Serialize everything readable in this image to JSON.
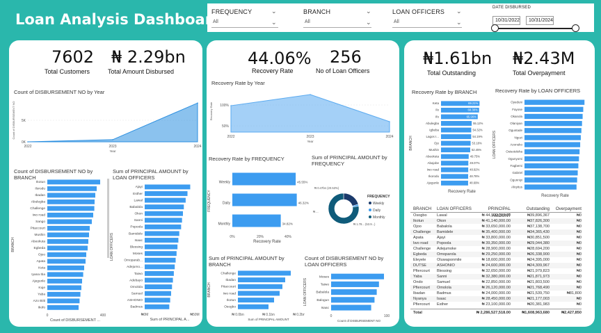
{
  "app_title": "Loan Analysis Dashboard",
  "filters": {
    "frequency": {
      "label": "FREQUENCY",
      "value": "All"
    },
    "branch": {
      "label": "BRANCH",
      "value": "All"
    },
    "loan_officers": {
      "label": "LOAN OFFICERS",
      "value": "All"
    },
    "date": {
      "label": "DATE DISBURSED",
      "start": "10/31/2022",
      "end": "10/31/2024"
    }
  },
  "kpis": {
    "total_customers": {
      "value": "7602",
      "label": "Total Customers"
    },
    "total_disbursed": {
      "value": "₦ 2.29bn",
      "label": "Total Amount Disbursed"
    },
    "recovery_rate": {
      "value": "44.06%",
      "label": "Recovery Rate"
    },
    "loan_officers": {
      "value": "256",
      "label": "No of Loan Officers"
    },
    "total_outstanding": {
      "value": "₦1.61bn",
      "label": "Total Outstanding"
    },
    "total_overpayment": {
      "value": "₦2.43M",
      "label": "Total Overpayment"
    }
  },
  "chart_data": [
    {
      "id": "disb_by_year",
      "type": "area",
      "title": "Count of DISBURSEMENT NO by Year",
      "xlabel": "Year",
      "ylabel": "Count of DISBURSEMENT NO",
      "x": [
        "2022",
        "2023",
        "2024"
      ],
      "values": [
        0,
        400,
        7200
      ],
      "yticks": [
        "0K",
        "5K"
      ],
      "ylim": [
        0,
        8000
      ],
      "color": "#2b8fe0"
    },
    {
      "id": "recovery_by_year",
      "type": "area",
      "title": "Recovery Rate by Year",
      "xlabel": "Year",
      "ylabel": "Recovery Rate",
      "x": [
        "2022",
        "2023",
        "2024"
      ],
      "values": [
        78,
        94,
        55
      ],
      "yticks": [
        "50%",
        "100%"
      ],
      "ylim": [
        40,
        100
      ],
      "color": "#5aaaf0"
    },
    {
      "id": "disb_by_branch",
      "type": "bar",
      "title": "Count of DISBURSEMENT NO by BRANCH",
      "xlabel": "Count of DISBURSEMENT ...",
      "ylabel": "BRANCH",
      "categories": [
        "Ikotun",
        "Ilorodu",
        "Ibadan",
        "Abulegba",
        "Challenge",
        "Iwo road",
        "Sango",
        "Pitaccourt",
        "Mushin",
        "Abeokuta",
        "Egbeda",
        "Ojoo",
        "Apata",
        "Keta",
        "Iyana Iba",
        "Ajegunle",
        "Kuje",
        "Yaba",
        "Azo Biiti",
        "Ikofo"
      ],
      "values": [
        380,
        355,
        345,
        340,
        338,
        330,
        320,
        305,
        300,
        295,
        290,
        280,
        275,
        265,
        258,
        250,
        245,
        238,
        232,
        225
      ],
      "xticks": [
        "0",
        "400"
      ],
      "xlim": [
        0,
        400
      ],
      "color": "#3c9cf0"
    },
    {
      "id": "principal_by_officer",
      "type": "bar",
      "title": "Sum of PRINCIPAL AMOUNT by LOAN OFFICERS",
      "xlabel": "Sum of PRINCIPAL A...",
      "ylabel": "LOAN OFFICERS",
      "categories": [
        "Ajayi",
        "Esther",
        "Lawal",
        "Babalola",
        "Okon",
        "Sanni",
        "Popoola",
        "Bamidele",
        "Isaac",
        "Blessing",
        "Moses",
        "Omoparab...",
        "Adejumo...",
        "Taiwo",
        "Adebayo",
        "Omolola",
        "Samuel",
        "ASHONIO",
        "Badmus"
      ],
      "values": [
        50,
        47,
        45,
        43,
        42,
        41,
        40,
        38,
        37,
        36,
        35,
        34,
        33,
        32,
        31,
        30,
        29,
        28,
        27
      ],
      "xticks": [
        "₦0M",
        "₦50M"
      ],
      "xlim": [
        0,
        55
      ],
      "color": "#3c9cf0"
    },
    {
      "id": "recovery_by_frequency",
      "type": "bar",
      "title": "Recovery Rate by FREQUENCY",
      "xlabel": "Recovery Rate",
      "ylabel": "FREQUENCY",
      "categories": [
        "Weekly",
        "Daily",
        "Monthly"
      ],
      "values": [
        45.55,
        46.32,
        34.82
      ],
      "labels": [
        "45.55%",
        "46.32%",
        "34.82%"
      ],
      "xticks": [
        "0%",
        "20%",
        "40%"
      ],
      "xlim": [
        0,
        50
      ],
      "color": "#3c9cf0"
    },
    {
      "id": "principal_by_frequency",
      "type": "pie",
      "title": "Sum of PRINCIPAL AMOUNT by FREQUENCY",
      "legend_title": "FREQUENCY",
      "categories": [
        "Weekly",
        "Daily",
        "Monthly"
      ],
      "values": [
        20.5,
        1.9,
        77.6
      ],
      "labels": [
        "₦ 0.47bn (20.53%)",
        "₦ ...",
        "₦ 1.78... (53.9...)"
      ],
      "colors": [
        "#1b3a6b",
        "#3c9cf0",
        "#0f5b7a"
      ]
    },
    {
      "id": "recovery_by_branch",
      "type": "bar",
      "title": "Recovery Rate by BRANCH",
      "xlabel": "Recovery Rate",
      "ylabel": "BRANCH",
      "categories": [
        "Keta",
        "Ilo",
        "Ifo",
        "Abulegba",
        "Igbeba",
        "Lagos I...",
        "Ojo",
        "Mushin",
        "Abeokuta",
        "Abajobe",
        "Iwo road",
        "Ikorodu",
        "Ajegunle"
      ],
      "values": [
        69.21,
        68.38,
        65.96,
        55.12,
        54.32,
        54.19,
        53.18,
        52.45,
        49.75,
        49.07,
        48.92,
        48.78,
        48.69
      ],
      "labels": [
        "69.21%",
        "68.38%",
        "65.96%",
        "55.12%",
        "54.32%",
        "54.19%",
        "53.18%",
        "52.45%",
        "49.75%",
        "49.07%",
        "48.92%",
        "48.78%",
        "48.69%"
      ],
      "xlim": [
        0,
        75
      ],
      "color": "#3c9cf0"
    },
    {
      "id": "recovery_by_officer",
      "type": "bar",
      "title": "Recovery Rate by LOAN OFFICERS",
      "xlabel": "Recovery Rate",
      "ylabel": "LOAN OFFICERS",
      "categories": [
        "Oyeduni",
        "Fayose",
        "Okanola",
        "Olaniyan",
        "Oguntade",
        "Ngozi",
        "Azonuko",
        "Osisotoleha",
        "Ogunyomi",
        "Fagbemi",
        "Gabriel",
        "Ogunniyi",
        "Afeyitus"
      ],
      "values": [
        98,
        96,
        95,
        94,
        93,
        92,
        91,
        90,
        89,
        88,
        87,
        86,
        85
      ],
      "xlim": [
        0,
        100
      ],
      "color": "#3c9cf0"
    },
    {
      "id": "principal_by_branch",
      "type": "bar",
      "title": "Sum of PRINCIPAL AMOUNT by BRANCH",
      "xlabel": "Sum of PRINCIPAL AMOUNT",
      "ylabel": "BRANCH",
      "categories": [
        "Challenge",
        "Ibadan",
        "Pitaccourt",
        "Iwo road",
        "Ikotun",
        "Osogbo"
      ],
      "values": [
        0.19,
        0.17,
        0.16,
        0.15,
        0.13,
        0.11
      ],
      "xticks": [
        "₦ 0.0bn",
        "₦ 0.1bn",
        "₦ 0.2bn"
      ],
      "xlim": [
        0,
        0.22
      ],
      "color": "#3c9cf0"
    },
    {
      "id": "disb_by_officer",
      "type": "bar",
      "title": "Count of DISBURSEMENT NO by LOAN OFFICERS",
      "xlabel": "Count of DISBURSEMENT NO",
      "ylabel": "LOAN OFFICERS",
      "categories": [
        "Moses",
        "Taiwo",
        "Babalola",
        "Balogun",
        "Isaac"
      ],
      "values": [
        95,
        86,
        82,
        78,
        72
      ],
      "xticks": [
        "0",
        "100"
      ],
      "xlim": [
        0,
        100
      ],
      "color": "#3c9cf0"
    }
  ],
  "table": {
    "headers": [
      "BRANCH",
      "LOAN OFFICERS",
      "PRINCIPAL AMOUNT",
      "Outstanding",
      "Overpayment"
    ],
    "rows": [
      [
        "Osogbo",
        "Lawal",
        "₦ 44,900,000.00",
        "₦39,896,367",
        "₦0"
      ],
      [
        "Ikotun",
        "Okon",
        "₦ 41,140,000.00",
        "₦37,826,300",
        "₦0"
      ],
      [
        "Ojoo",
        "Babalola",
        "₦ 33,650,000.00",
        "₦37,138,700",
        "₦0"
      ],
      [
        "Challenge",
        "Bamidele",
        "₦ 35,400,000.00",
        "₦34,365,430",
        "₦0"
      ],
      [
        "Apata",
        "Ajayi",
        "₦ 33,800,000.00",
        "₦30,851,500",
        "₦0"
      ],
      [
        "Iwo road",
        "Popoola",
        "₦ 39,350,000.00",
        "₦29,044,380",
        "₦0"
      ],
      [
        "Challenge",
        "Adejumoke",
        "₦ 28,900,000.00",
        "₦28,694,200",
        "₦0"
      ],
      [
        "Egbeda",
        "Omoparola",
        "₦ 29,250,000.00",
        "₦26,338,900",
        "₦0"
      ],
      [
        "Eleyele",
        "Oluwaponmile",
        "₦ 18,600,000.00",
        "₦24,395,000",
        "₦0"
      ],
      [
        "DUTSE",
        "ASHONIO",
        "₦ 24,600,000.00",
        "₦24,309,967",
        "₦0"
      ],
      [
        "Pfiercourt",
        "Blessing",
        "₦ 32,650,000.00",
        "₦21,979,823",
        "₦0"
      ],
      [
        "Yaba",
        "Sanni",
        "₦ 32,380,000.00",
        "₦21,871,973",
        "₦0"
      ],
      [
        "Ondo",
        "Samuel",
        "₦ 22,850,000.00",
        "₦21,803,500",
        "₦0"
      ],
      [
        "Pfiercourt",
        "Omolola",
        "₦ 26,120,000.00",
        "₦21,768,490",
        "₦0"
      ],
      [
        "Ibadan",
        "Badmus",
        "₦ 24,000,000.00",
        "₦21,539,750",
        "₦81,800"
      ],
      [
        "Nyanya",
        "Isaac",
        "₦ 28,450,000.00",
        "₦21,177,003",
        "₦0"
      ],
      [
        "Pfiercourt",
        "Esther",
        "₦ 23,100,000.00",
        "₦20,381,983",
        "₦0"
      ]
    ],
    "total": [
      "Total",
      "",
      "₦ 2,286,527,518.00",
      "₦1,608,963,680",
      "₦2,427,850"
    ]
  }
}
